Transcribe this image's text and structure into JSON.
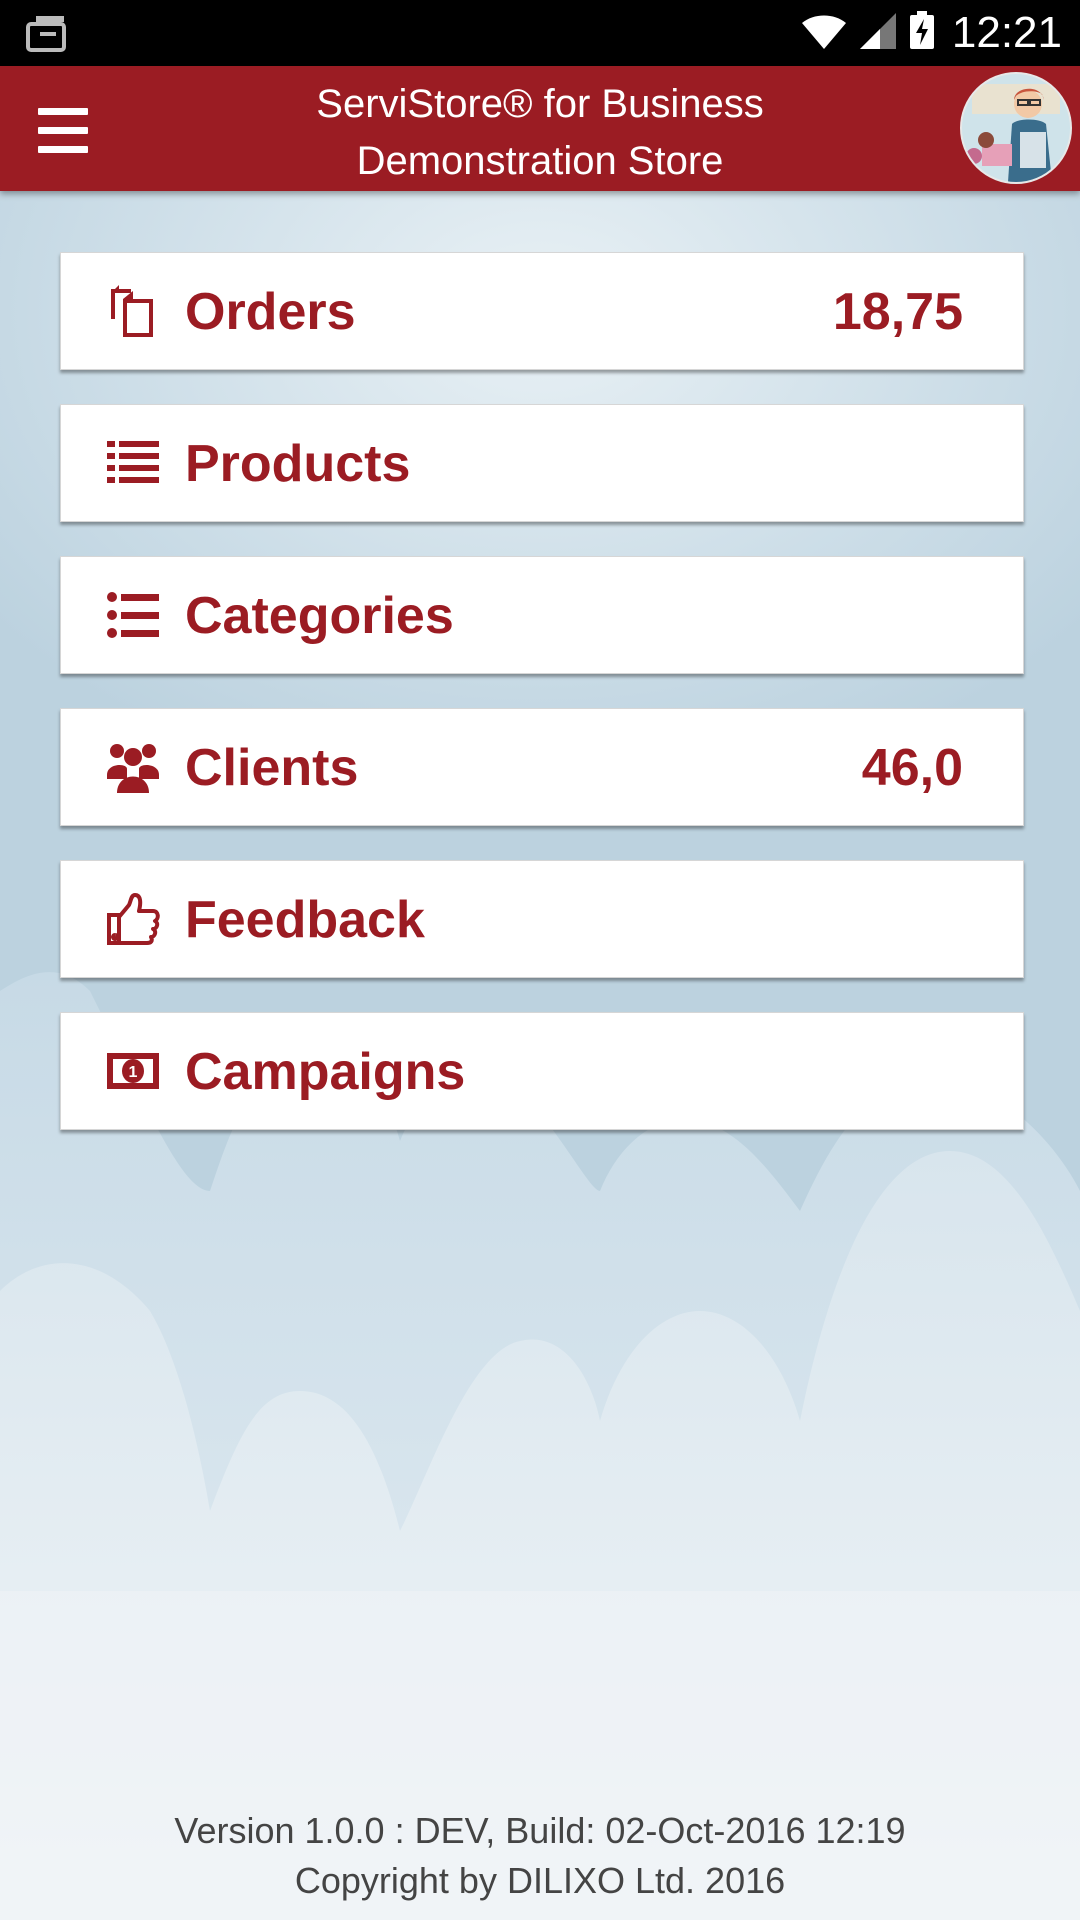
{
  "status_bar": {
    "time": "12:21",
    "icons": [
      "download-notification-icon",
      "wifi-icon",
      "cell-signal-icon",
      "battery-charging-icon"
    ]
  },
  "header": {
    "title_line1": "ServiStore® for Business",
    "title_line2": "Demonstration Store",
    "menu_icon": "hamburger-menu-icon",
    "avatar": "store-avatar"
  },
  "menu": {
    "items": [
      {
        "label": "Orders",
        "value": "18,75",
        "icon": "orders-icon"
      },
      {
        "label": "Products",
        "value": "",
        "icon": "list-icon"
      },
      {
        "label": "Categories",
        "value": "",
        "icon": "list-bullets-icon"
      },
      {
        "label": "Clients",
        "value": "46,0",
        "icon": "users-icon"
      },
      {
        "label": "Feedback",
        "value": "",
        "icon": "thumbs-up-icon"
      },
      {
        "label": "Campaigns",
        "value": "",
        "icon": "money-icon"
      }
    ]
  },
  "footer": {
    "version": "Version 1.0.0 : DEV, Build: 02-Oct-2016 12:19",
    "copyright": "Copyright by DILIXO Ltd. 2016"
  },
  "colors": {
    "brand": "#9b1c23",
    "card_bg": "#ffffff",
    "status_bar": "#000000"
  }
}
